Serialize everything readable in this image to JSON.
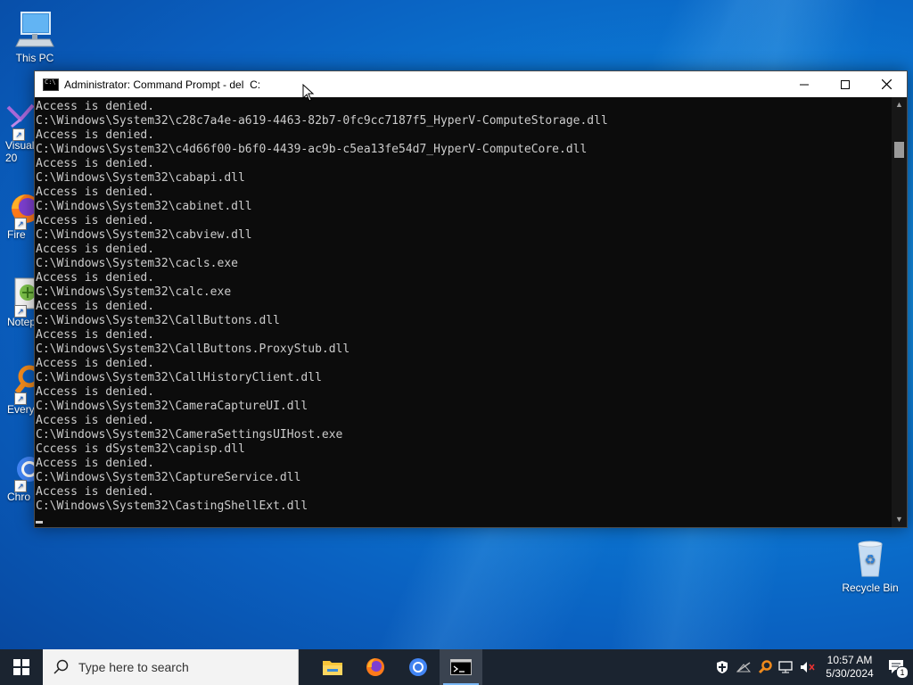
{
  "desktop": {
    "icons": [
      {
        "name": "this-pc",
        "label": "This PC"
      },
      {
        "name": "visual-studio",
        "label": "Visual\n20"
      },
      {
        "name": "firefox",
        "label": "Fire"
      },
      {
        "name": "notepad",
        "label": "Notep"
      },
      {
        "name": "everything",
        "label": "Every"
      },
      {
        "name": "chrome",
        "label": "Chro"
      }
    ],
    "recycle_bin": "Recycle Bin"
  },
  "cmd": {
    "title": "Administrator: Command Prompt - del  C:",
    "lines": [
      "Access is denied.",
      "C:\\Windows\\System32\\c28c7a4e-a619-4463-82b7-0fc9cc7187f5_HyperV-ComputeStorage.dll",
      "Access is denied.",
      "C:\\Windows\\System32\\c4d66f00-b6f0-4439-ac9b-c5ea13fe54d7_HyperV-ComputeCore.dll",
      "Access is denied.",
      "C:\\Windows\\System32\\cabapi.dll",
      "Access is denied.",
      "C:\\Windows\\System32\\cabinet.dll",
      "Access is denied.",
      "C:\\Windows\\System32\\cabview.dll",
      "Access is denied.",
      "C:\\Windows\\System32\\cacls.exe",
      "Access is denied.",
      "C:\\Windows\\System32\\calc.exe",
      "Access is denied.",
      "C:\\Windows\\System32\\CallButtons.dll",
      "Access is denied.",
      "C:\\Windows\\System32\\CallButtons.ProxyStub.dll",
      "Access is denied.",
      "C:\\Windows\\System32\\CallHistoryClient.dll",
      "Access is denied.",
      "C:\\Windows\\System32\\CameraCaptureUI.dll",
      "Access is denied.",
      "C:\\Windows\\System32\\CameraSettingsUIHost.exe",
      "Cccess is dSystem32\\capisp.dll",
      "Access is denied.",
      "C:\\Windows\\System32\\CaptureService.dll",
      "Access is denied.",
      "C:\\Windows\\System32\\CastingShellExt.dll"
    ]
  },
  "taskbar": {
    "search_placeholder": "Type here to search",
    "time": "10:57 AM",
    "date": "5/30/2024",
    "notification_count": "1"
  }
}
